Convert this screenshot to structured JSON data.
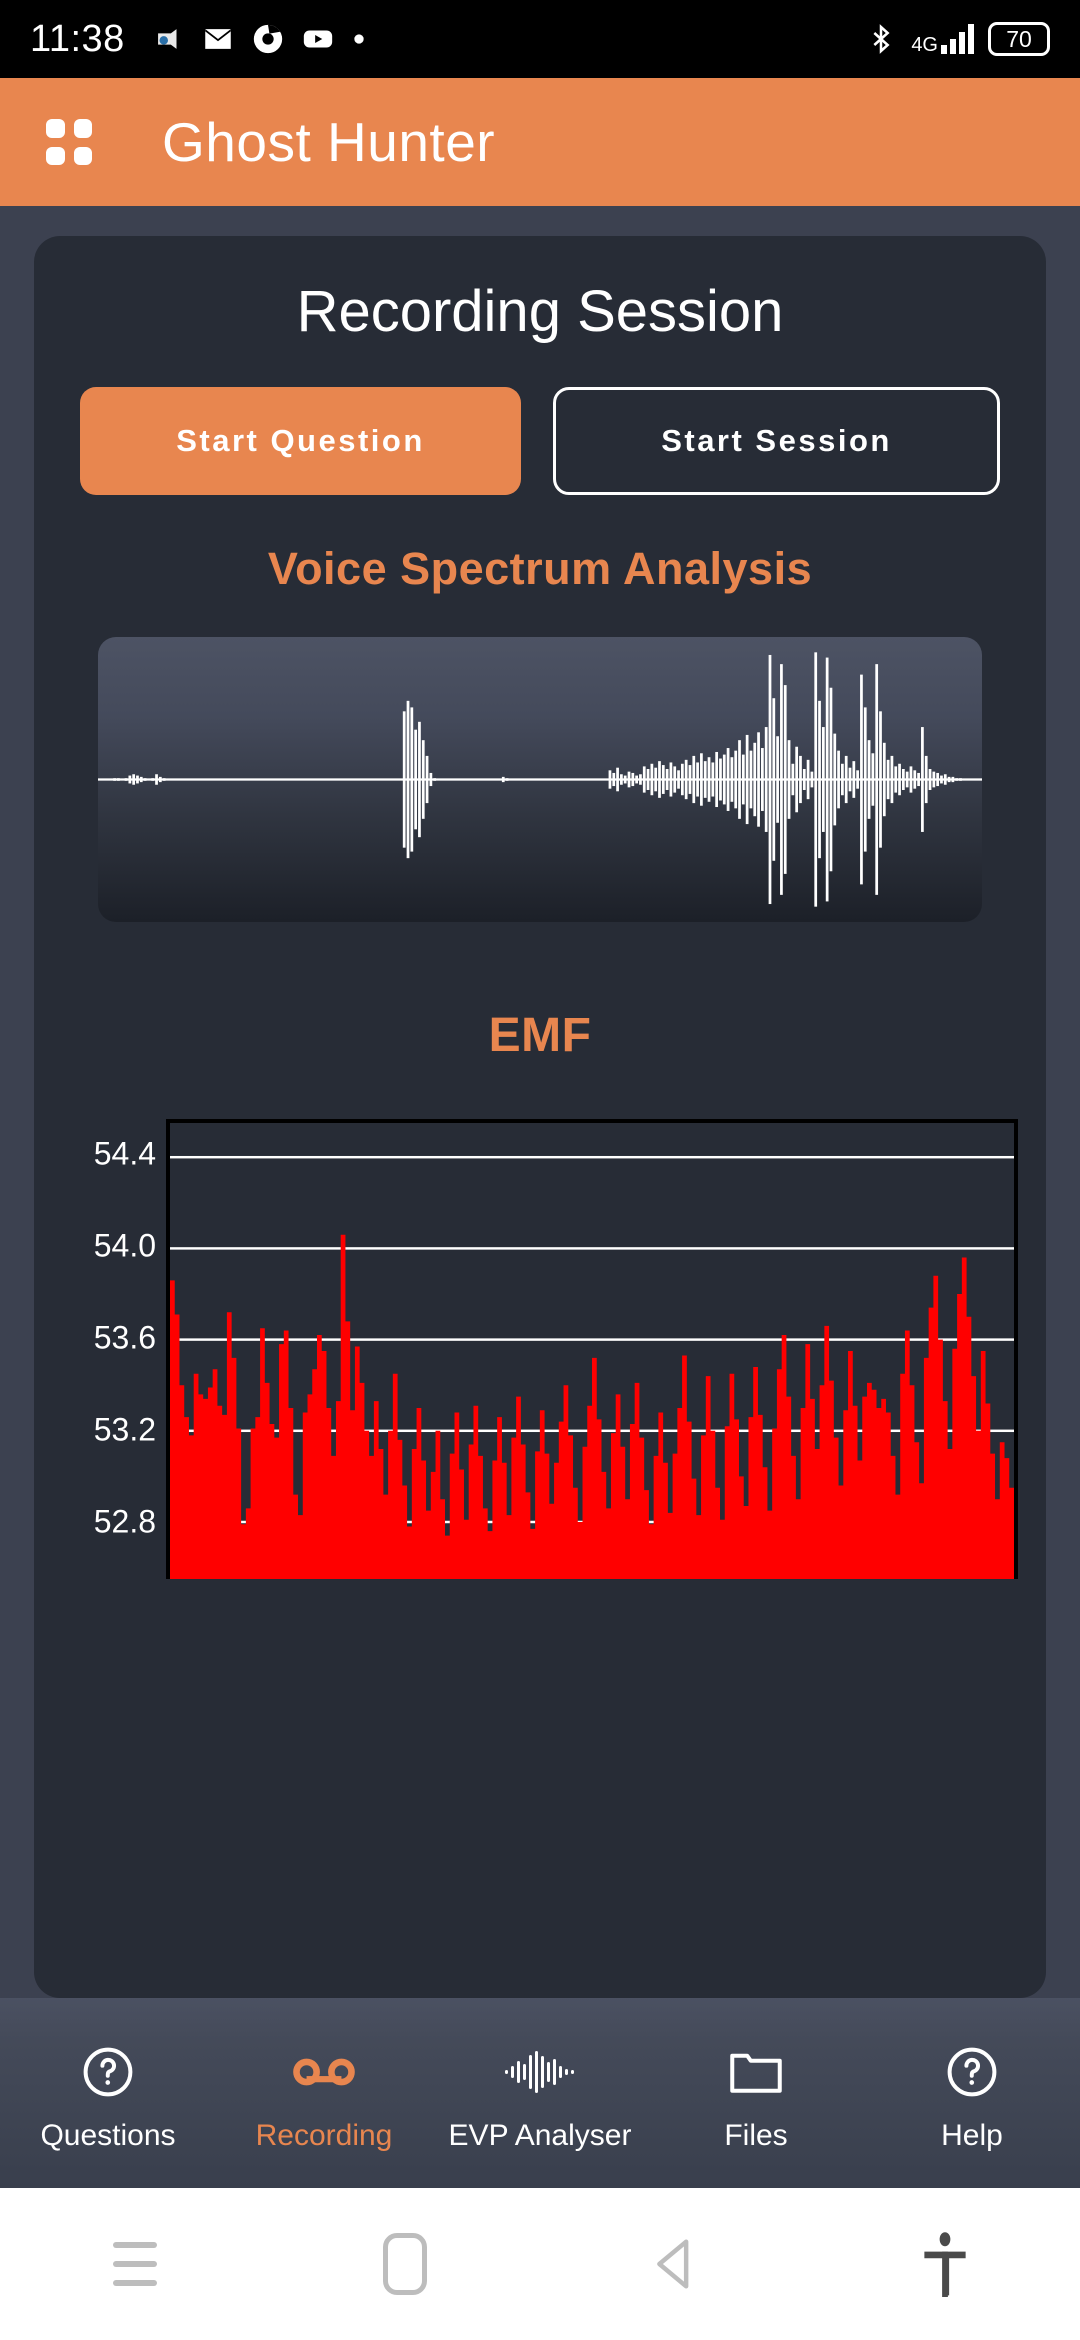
{
  "statusbar": {
    "time": "11:38",
    "battery_level": "70",
    "network": "4G",
    "left_icons": [
      "camera-icon",
      "email-icon",
      "chrome-icon",
      "youtube-icon",
      "dot-icon"
    ],
    "right_icons": [
      "bluetooth-icon",
      "signal-icon",
      "battery-icon"
    ]
  },
  "appbar": {
    "title": "Ghost Hunter",
    "menu_icon": "grid-menu-icon",
    "background": "#e8864f"
  },
  "main": {
    "card_title": "Recording Session",
    "buttons": {
      "primary": "Start Question",
      "secondary": "Start Session"
    },
    "voice_section_title": "Voice Spectrum Analysis",
    "emf_section_title": "EMF"
  },
  "bottom_nav": {
    "items": [
      {
        "label": "Questions",
        "icon": "question-circle-icon",
        "active": false
      },
      {
        "label": "Recording",
        "icon": "voicemail-icon",
        "active": true
      },
      {
        "label": "EVP Analyser",
        "icon": "waveform-icon",
        "active": false
      },
      {
        "label": "Files",
        "icon": "folder-icon",
        "active": false
      },
      {
        "label": "Help",
        "icon": "question-circle-icon",
        "active": false
      }
    ],
    "active_color": "#e8864f",
    "inactive_color": "#ffffff"
  },
  "android_nav": {
    "items": [
      "recents-icon",
      "home-icon",
      "back-icon",
      "accessibility-icon"
    ]
  },
  "chart_data": [
    {
      "type": "line",
      "name": "voice-spectrum-waveform",
      "title": "Voice Spectrum Analysis",
      "xlabel": "",
      "ylabel": "",
      "grid": false,
      "legend": "none",
      "series_color": "#ffffff",
      "description": "Mono audio waveform, amplitude mirrored about centreline, quiet at left with two isolated transients then a loud burst of speech at right",
      "amplitudes": [
        0.0,
        0.0,
        0.0,
        0.0,
        0.01,
        0.01,
        0.0,
        0.01,
        0.03,
        0.04,
        0.03,
        0.02,
        0.01,
        0.0,
        0.01,
        0.04,
        0.02,
        0.01,
        0.0,
        0.0,
        0.0,
        0.0,
        0.0,
        0.0,
        0.0,
        0.0,
        0.0,
        0.0,
        0.0,
        0.0,
        0.0,
        0.0,
        0.0,
        0.0,
        0.0,
        0.0,
        0.0,
        0.0,
        0.0,
        0.0,
        0.0,
        0.0,
        0.0,
        0.0,
        0.0,
        0.0,
        0.0,
        0.0,
        0.0,
        0.0,
        0.0,
        0.0,
        0.0,
        0.0,
        0.0,
        0.0,
        0.0,
        0.0,
        0.0,
        0.0,
        0.0,
        0.0,
        0.0,
        0.0,
        0.0,
        0.0,
        0.0,
        0.0,
        0.0,
        0.0,
        0.0,
        0.0,
        0.0,
        0.0,
        0.0,
        0.0,
        0.0,
        0.0,
        0.0,
        0.0,
        0.52,
        0.6,
        0.55,
        0.38,
        0.44,
        0.3,
        0.18,
        0.05,
        0.01,
        0.0,
        0.0,
        0.0,
        0.0,
        0.0,
        0.0,
        0.0,
        0.0,
        0.0,
        0.0,
        0.0,
        0.0,
        0.0,
        0.0,
        0.0,
        0.0,
        0.0,
        0.02,
        0.01,
        0.0,
        0.0,
        0.0,
        0.0,
        0.0,
        0.0,
        0.0,
        0.0,
        0.0,
        0.0,
        0.0,
        0.0,
        0.0,
        0.0,
        0.0,
        0.0,
        0.0,
        0.0,
        0.0,
        0.0,
        0.0,
        0.0,
        0.0,
        0.0,
        0.0,
        0.0,
        0.07,
        0.05,
        0.09,
        0.04,
        0.03,
        0.06,
        0.05,
        0.03,
        0.04,
        0.1,
        0.08,
        0.12,
        0.09,
        0.14,
        0.11,
        0.08,
        0.13,
        0.1,
        0.07,
        0.12,
        0.15,
        0.11,
        0.18,
        0.13,
        0.2,
        0.14,
        0.17,
        0.13,
        0.21,
        0.16,
        0.19,
        0.24,
        0.17,
        0.22,
        0.3,
        0.19,
        0.34,
        0.22,
        0.28,
        0.36,
        0.24,
        0.4,
        0.95,
        0.62,
        0.33,
        0.88,
        0.72,
        0.3,
        0.12,
        0.25,
        0.18,
        0.08,
        0.15,
        0.06,
        0.97,
        0.6,
        0.4,
        0.93,
        0.7,
        0.35,
        0.22,
        0.12,
        0.18,
        0.09,
        0.14,
        0.07,
        0.8,
        0.55,
        0.3,
        0.2,
        0.88,
        0.52,
        0.28,
        0.15,
        0.18,
        0.1,
        0.12,
        0.08,
        0.06,
        0.1,
        0.07,
        0.05,
        0.4,
        0.18,
        0.08,
        0.06,
        0.05,
        0.03,
        0.04,
        0.02,
        0.02,
        0.01,
        0.01,
        0.0,
        0.0,
        0.0,
        0.0,
        0.0
      ]
    },
    {
      "type": "line",
      "name": "emf-chart",
      "title": "EMF",
      "xlabel": "",
      "ylabel": "",
      "yticks": [
        "54.4",
        "54.0",
        "53.6",
        "53.2",
        "52.8"
      ],
      "ytick_values": [
        54.4,
        54.0,
        53.6,
        53.2,
        52.8
      ],
      "ylim": [
        52.55,
        54.55
      ],
      "grid": true,
      "grid_color": "#ffffff",
      "legend": "none",
      "series_color": "#ff0000",
      "values": [
        53.86,
        53.71,
        53.4,
        53.26,
        53.18,
        53.45,
        53.36,
        53.34,
        53.39,
        53.47,
        53.31,
        53.27,
        53.72,
        53.52,
        53.21,
        52.79,
        52.86,
        53.21,
        53.26,
        53.65,
        53.41,
        53.23,
        53.17,
        53.58,
        53.64,
        53.3,
        52.92,
        52.83,
        53.28,
        53.36,
        53.47,
        53.62,
        53.55,
        53.3,
        53.09,
        53.33,
        54.06,
        53.68,
        53.29,
        53.57,
        53.41,
        53.2,
        53.09,
        53.33,
        53.12,
        52.92,
        53.2,
        53.45,
        53.16,
        52.96,
        52.78,
        53.12,
        53.3,
        53.07,
        52.85,
        53.02,
        53.2,
        52.9,
        52.74,
        53.1,
        53.28,
        53.03,
        52.81,
        53.14,
        53.31,
        53.09,
        52.86,
        52.76,
        53.07,
        53.26,
        53.06,
        52.83,
        53.17,
        53.35,
        53.14,
        52.93,
        52.77,
        53.11,
        53.29,
        53.1,
        52.88,
        53.06,
        53.24,
        53.4,
        53.18,
        52.95,
        52.8,
        53.13,
        53.31,
        53.52,
        53.25,
        53.02,
        52.86,
        53.19,
        53.36,
        53.13,
        52.9,
        53.23,
        53.41,
        53.17,
        52.94,
        52.79,
        53.09,
        53.28,
        53.06,
        52.84,
        53.1,
        53.3,
        53.53,
        53.24,
        52.99,
        52.83,
        53.18,
        53.44,
        53.2,
        52.95,
        52.81,
        53.22,
        53.45,
        53.25,
        53.0,
        52.87,
        53.26,
        53.48,
        53.27,
        53.04,
        52.85,
        53.21,
        53.47,
        53.62,
        53.35,
        53.09,
        52.9,
        53.3,
        53.58,
        53.34,
        53.12,
        53.4,
        53.66,
        53.42,
        53.17,
        52.96,
        53.29,
        53.55,
        53.31,
        53.07,
        53.35,
        53.41,
        53.38,
        53.3,
        53.34,
        53.28,
        53.09,
        52.92,
        53.45,
        53.64,
        53.4,
        53.15,
        52.97,
        53.52,
        53.74,
        53.88,
        53.6,
        53.33,
        53.12,
        53.56,
        53.8,
        53.96,
        53.7,
        53.44,
        53.2,
        53.55,
        53.32,
        53.1,
        52.9,
        53.15,
        53.08,
        52.95,
        53.03
      ]
    }
  ]
}
